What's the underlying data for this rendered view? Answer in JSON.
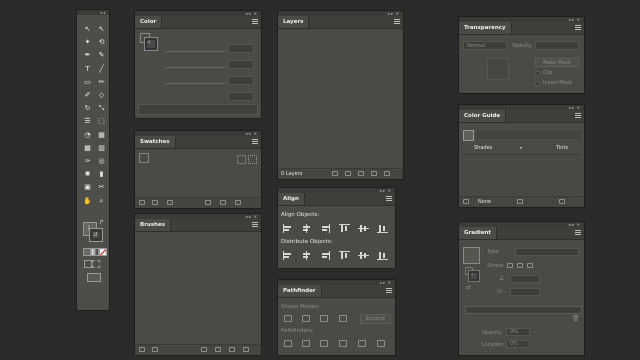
{
  "color_panel": {
    "tab": "Color"
  },
  "swatches_panel": {
    "tab": "Swatches"
  },
  "brushes_panel": {
    "tab": "Brushes"
  },
  "layers_panel": {
    "tab": "Layers",
    "footer_count": "0 Layers"
  },
  "align_panel": {
    "tab": "Align",
    "align_objects": "Align Objects:",
    "distribute_objects": "Distribute Objects:"
  },
  "pathfinder_panel": {
    "tab": "Pathfinder",
    "shape_modes": "Shape Modes:",
    "expand": "Expand",
    "pathfinders": "Pathfinders:"
  },
  "transparency_panel": {
    "tab": "Transparency",
    "blend_mode": "Normal",
    "opacity_label": "Opacity:",
    "make_mask": "Make Mask",
    "clip": "Clip",
    "invert_mask": "Invert Mask"
  },
  "color_guide_panel": {
    "tab": "Color Guide",
    "shades": "Shades",
    "tints": "Tints",
    "harmony": "None"
  },
  "gradient_panel": {
    "tab": "Gradient",
    "type_label": "Type:",
    "stroke_label": "Stroke:",
    "opacity_label": "Opacity:",
    "location_label": "Location:",
    "opacity_value": "0%",
    "location_value": "0%"
  },
  "tools": [
    {
      "glyph": "↖",
      "icon": "selection-tool-icon"
    },
    {
      "glyph": "↖",
      "icon": "direct-selection-tool-icon"
    },
    {
      "glyph": "✦",
      "icon": "magic-wand-icon"
    },
    {
      "glyph": "⟲",
      "icon": "lasso-icon"
    },
    {
      "glyph": "✒",
      "icon": "pen-tool-icon"
    },
    {
      "glyph": "✎",
      "icon": "curvature-tool-icon"
    },
    {
      "glyph": "T",
      "icon": "type-tool-icon"
    },
    {
      "glyph": "╱",
      "icon": "line-tool-icon"
    },
    {
      "glyph": "▭",
      "icon": "rectangle-tool-icon"
    },
    {
      "glyph": "✏",
      "icon": "paintbrush-icon"
    },
    {
      "glyph": "✐",
      "icon": "pencil-icon"
    },
    {
      "glyph": "◇",
      "icon": "eraser-icon"
    },
    {
      "glyph": "↻",
      "icon": "rotate-tool-icon"
    },
    {
      "glyph": "⤡",
      "icon": "scale-tool-icon"
    },
    {
      "glyph": "☰",
      "icon": "width-tool-icon"
    },
    {
      "glyph": "⬚",
      "icon": "free-transform-icon"
    },
    {
      "glyph": "◔",
      "icon": "shape-builder-icon"
    },
    {
      "glyph": "▦",
      "icon": "perspective-grid-icon"
    },
    {
      "glyph": "▩",
      "icon": "mesh-tool-icon"
    },
    {
      "glyph": "▥",
      "icon": "gradient-tool-icon"
    },
    {
      "glyph": "✑",
      "icon": "eyedropper-icon"
    },
    {
      "glyph": "◎",
      "icon": "blend-tool-icon"
    },
    {
      "glyph": "✺",
      "icon": "symbol-sprayer-icon"
    },
    {
      "glyph": "▮",
      "icon": "column-graph-icon"
    },
    {
      "glyph": "▣",
      "icon": "artboard-tool-icon"
    },
    {
      "glyph": "✂",
      "icon": "slice-tool-icon"
    },
    {
      "glyph": "✋",
      "icon": "hand-tool-icon"
    },
    {
      "glyph": "⌕",
      "icon": "zoom-tool-icon"
    }
  ]
}
